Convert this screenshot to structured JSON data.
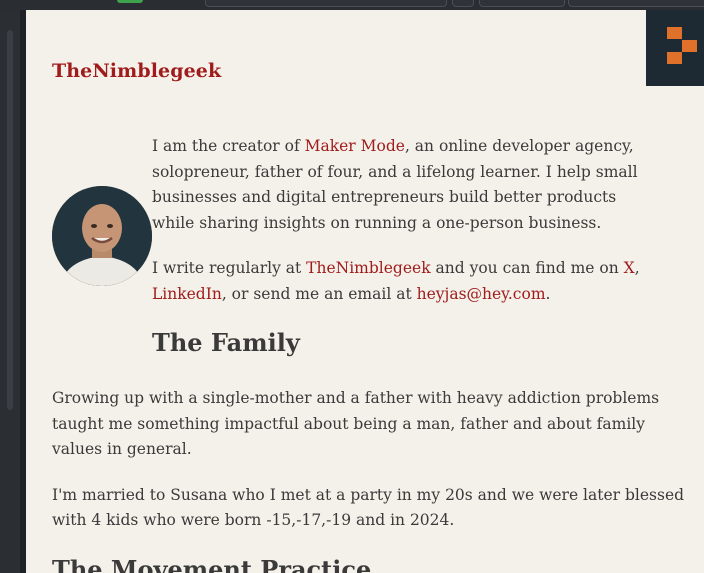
{
  "site": {
    "title": "TheNimblegeek"
  },
  "intro": {
    "p1_prefix": "I am the creator of ",
    "maker_mode_link": "Maker Mode",
    "p1_suffix": ", an online developer agency, solopreneur, father of four, and a lifelong learner. I help small businesses and digital entrepreneurs build better products while sharing insights on running a one-person business.",
    "p2_prefix": "I write regularly at ",
    "nimblegeek_link": "TheNimblegeek",
    "p2_mid": " and you can find me on ",
    "x_link": "X",
    "comma": ",",
    "linkedin_link": "LinkedIn",
    "p2_mid2": ", or send me an email at ",
    "email_link": "heyjas@hey.com",
    "period": "."
  },
  "family": {
    "heading": "The Family",
    "p1": "Growing up with a single-mother and a father with heavy addiction problems taught me something impactful about being a man, father and about family values in general.",
    "p2": "I'm married to Susana who I met at a party in my 20s and we were later blessed with 4 kids who were born -15,-17,-19 and in 2024."
  },
  "movement": {
    "heading": "The Movement Practice"
  },
  "colors": {
    "link": "#a01c1c",
    "background": "#f4f1ea",
    "logo_accent": "#e0712b"
  }
}
